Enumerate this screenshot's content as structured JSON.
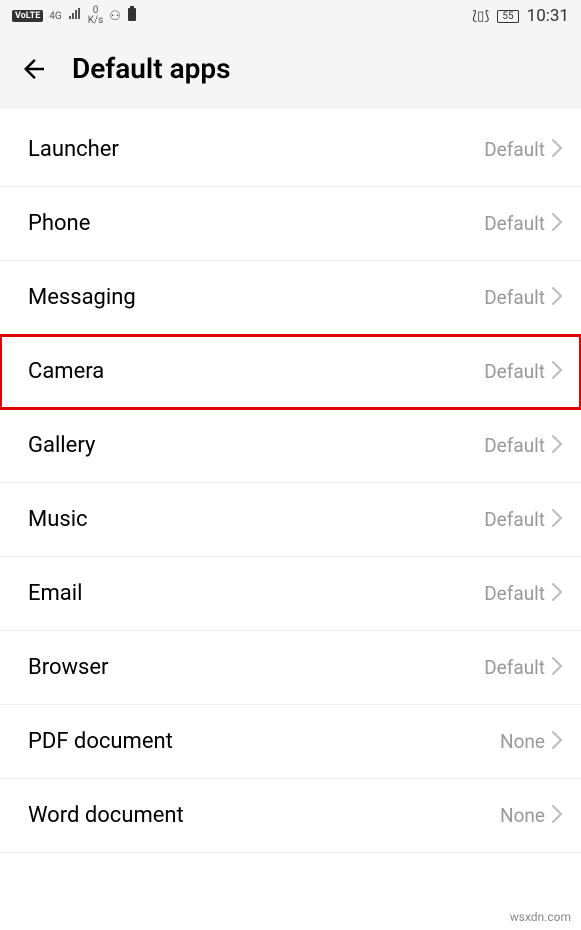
{
  "statusBar": {
    "volte": "VoLTE",
    "network": "4G",
    "speedTop": "0",
    "speedBottom": "K/s",
    "battery": "55",
    "time": "10:31"
  },
  "header": {
    "title": "Default apps"
  },
  "items": [
    {
      "label": "Launcher",
      "value": "Default",
      "highlighted": false
    },
    {
      "label": "Phone",
      "value": "Default",
      "highlighted": false
    },
    {
      "label": "Messaging",
      "value": "Default",
      "highlighted": false
    },
    {
      "label": "Camera",
      "value": "Default",
      "highlighted": true
    },
    {
      "label": "Gallery",
      "value": "Default",
      "highlighted": false
    },
    {
      "label": "Music",
      "value": "Default",
      "highlighted": false
    },
    {
      "label": "Email",
      "value": "Default",
      "highlighted": false
    },
    {
      "label": "Browser",
      "value": "Default",
      "highlighted": false
    },
    {
      "label": "PDF document",
      "value": "None",
      "highlighted": false
    },
    {
      "label": "Word document",
      "value": "None",
      "highlighted": false
    }
  ],
  "watermark": "wsxdn.com"
}
